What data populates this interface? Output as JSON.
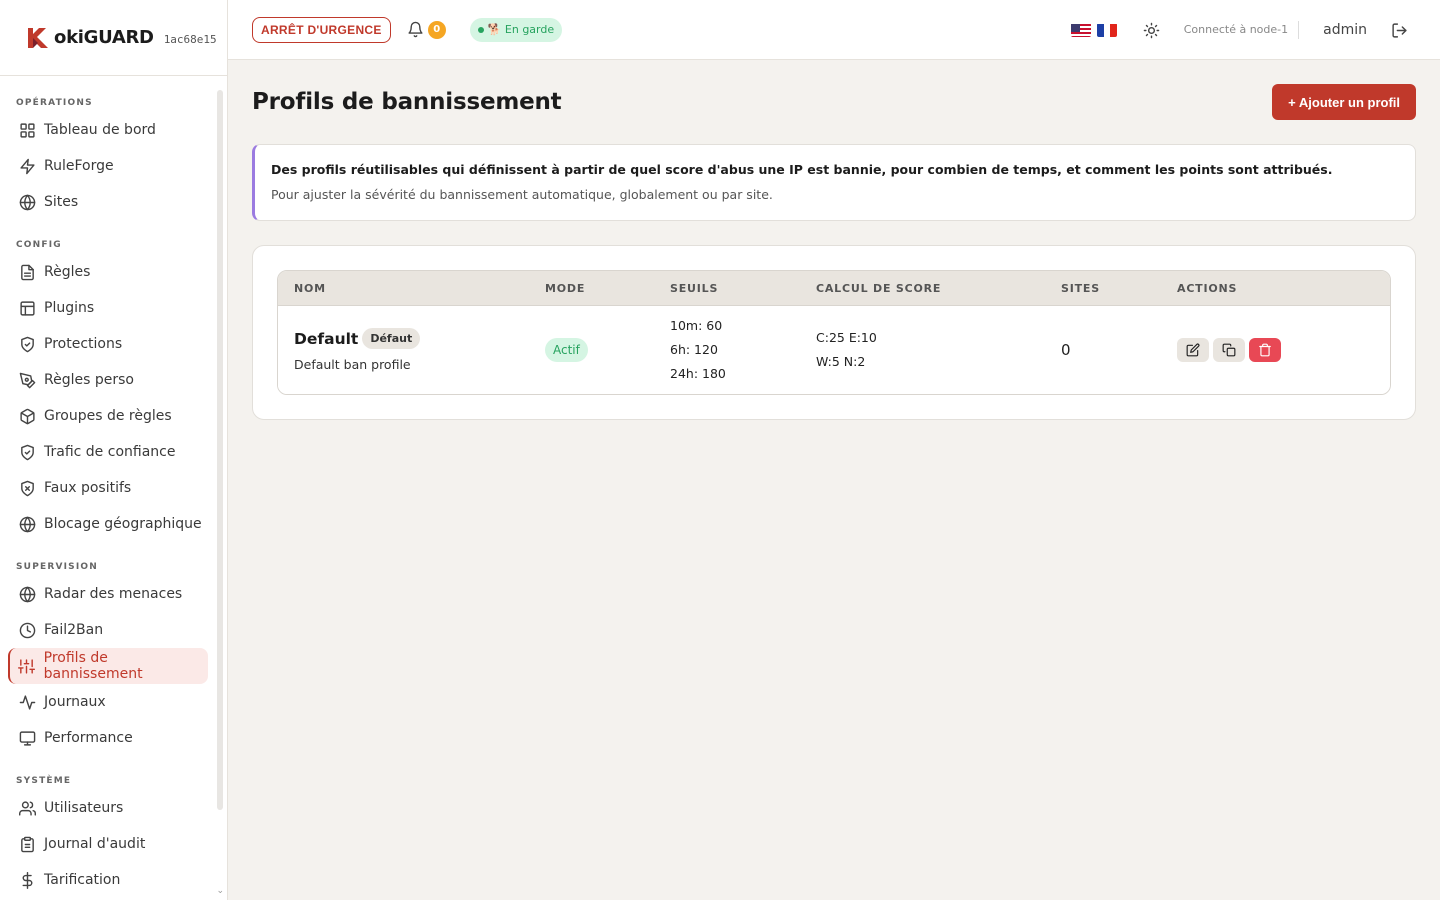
{
  "brand": {
    "name": "okiGUARD",
    "hash": "1ac68e15"
  },
  "sidebar": {
    "sections": [
      {
        "title": "OPÉRATIONS",
        "items": [
          {
            "label": "Tableau de bord",
            "icon": "grid-icon"
          },
          {
            "label": "RuleForge",
            "icon": "bolt-icon"
          },
          {
            "label": "Sites",
            "icon": "globe-icon"
          }
        ]
      },
      {
        "title": "CONFIG",
        "items": [
          {
            "label": "Règles",
            "icon": "file-icon"
          },
          {
            "label": "Plugins",
            "icon": "layout-icon"
          },
          {
            "label": "Protections",
            "icon": "shield-check-icon"
          },
          {
            "label": "Règles perso",
            "icon": "pen-tool-icon"
          },
          {
            "label": "Groupes de règles",
            "icon": "package-icon"
          },
          {
            "label": "Trafic de confiance",
            "icon": "shield-check-icon"
          },
          {
            "label": "Faux positifs",
            "icon": "shield-x-icon"
          },
          {
            "label": "Blocage géographique",
            "icon": "globe-icon"
          }
        ]
      },
      {
        "title": "SUPERVISION",
        "items": [
          {
            "label": "Radar des menaces",
            "icon": "globe-icon"
          },
          {
            "label": "Fail2Ban",
            "icon": "clock-icon"
          },
          {
            "label": "Profils de bannissement",
            "icon": "sliders-icon",
            "active": true
          },
          {
            "label": "Journaux",
            "icon": "activity-icon"
          },
          {
            "label": "Performance",
            "icon": "monitor-icon"
          }
        ]
      },
      {
        "title": "SYSTÈME",
        "items": [
          {
            "label": "Utilisateurs",
            "icon": "users-icon"
          },
          {
            "label": "Journal d'audit",
            "icon": "clipboard-icon"
          },
          {
            "label": "Tarification",
            "icon": "dollar-icon"
          }
        ]
      }
    ]
  },
  "topbar": {
    "emergency_label": "ARRÊT D'URGENCE",
    "notification_count": "0",
    "guard_status": "🐕 En garde",
    "connected_label": "Connecté à node-1",
    "user": "admin"
  },
  "page": {
    "title": "Profils de bannissement",
    "add_button": "+ Ajouter un profil",
    "info_strong": "Des profils réutilisables qui définissent à partir de quel score d'abus une IP est bannie, pour combien de temps, et comment les points sont attribués.",
    "info_sub": "Pour ajuster la sévérité du bannissement automatique, globalement ou par site."
  },
  "table": {
    "headers": [
      "NOM",
      "MODE",
      "SEUILS",
      "CALCUL DE SCORE",
      "SITES",
      "ACTIONS"
    ],
    "rows": [
      {
        "name": "Default",
        "badge": "Défaut",
        "description": "Default ban profile",
        "mode": "Actif",
        "thresholds": [
          "10m: 60",
          "6h: 120",
          "24h: 180"
        ],
        "score": [
          "C:25 E:10",
          "W:5 N:2"
        ],
        "sites": "0"
      }
    ]
  },
  "colors": {
    "accent": "#c0392b",
    "active_bg": "#fbe9e7",
    "success": "#27a35f",
    "info_border": "#9b7be0",
    "danger": "#e84855"
  }
}
